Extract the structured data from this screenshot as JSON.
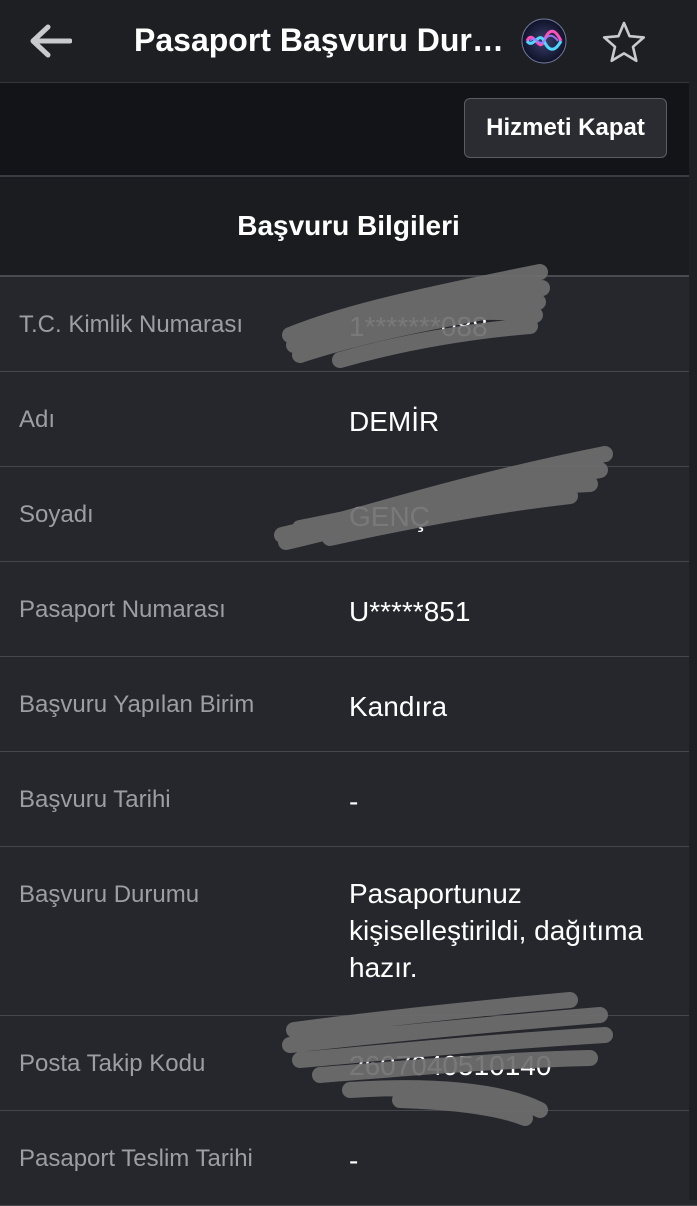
{
  "header": {
    "title": "Pasaport Başvuru Durum Sorgulama",
    "back_icon": "arrow-left-icon",
    "siri_icon": "siri-icon",
    "favorite_icon": "star-outline-icon"
  },
  "toolbar": {
    "close_service_label": "Hizmeti Kapat"
  },
  "section": {
    "title": "Başvuru Bilgileri"
  },
  "rows": [
    {
      "label": "T.C. Kimlik Numarası",
      "value": "1*******088",
      "redacted": true
    },
    {
      "label": "Adı",
      "value": "DEMİR"
    },
    {
      "label": "Soyadı",
      "value": "GENÇ",
      "redacted": true
    },
    {
      "label": "Pasaport Numarası",
      "value": "U*****851"
    },
    {
      "label": "Başvuru Yapılan Birim",
      "value": "Kandıra"
    },
    {
      "label": "Başvuru Tarihi",
      "value": "-"
    },
    {
      "label": "Başvuru Durumu",
      "value": "Pasaportunuz kişiselleştirildi, dağıtıma hazır."
    },
    {
      "label": "Posta Takip Kodu",
      "value": "2607040510140",
      "redacted": true
    },
    {
      "label": "Pasaport Teslim Tarihi",
      "value": "-"
    }
  ],
  "colors": {
    "background": "#25272d",
    "header_background": "#1d1f23",
    "label_text": "#9c9ea4",
    "value_text": "#ffffff",
    "divider": "#45474d",
    "redaction_scribble": "#6b6b6b"
  }
}
